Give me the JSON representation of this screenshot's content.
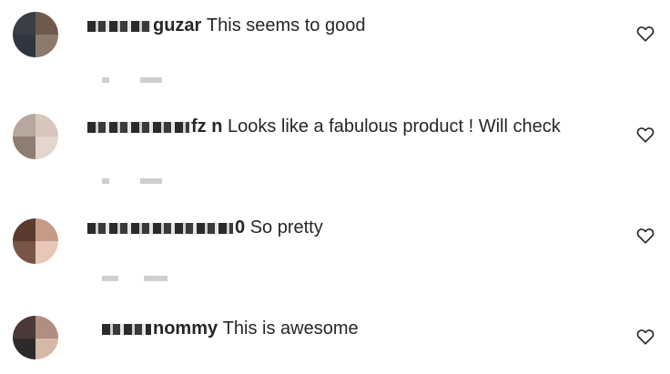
{
  "comments": [
    {
      "user_visible": "guzar",
      "text": "This seems to good",
      "avatar_colors": [
        "#3a3f45",
        "#6e5a4b",
        "#2f3640",
        "#8d7a6a"
      ]
    },
    {
      "user_visible": "fz   n",
      "text": "Looks like a fabulous product ! Will check",
      "avatar_colors": [
        "#b7a79c",
        "#d6c6bb",
        "#8f7d72",
        "#e2d6cd"
      ]
    },
    {
      "user_visible": "0",
      "text": "So pretty",
      "avatar_colors": [
        "#5a3b2f",
        "#c79a86",
        "#7a5445",
        "#e7c8b8"
      ]
    },
    {
      "user_visible": "nommy",
      "text": "This is awesome",
      "avatar_colors": [
        "#4b3a35",
        "#b08e82",
        "#2f2a2a",
        "#d6b8a8"
      ]
    }
  ],
  "icons": {
    "like": "heart-outline-icon"
  }
}
